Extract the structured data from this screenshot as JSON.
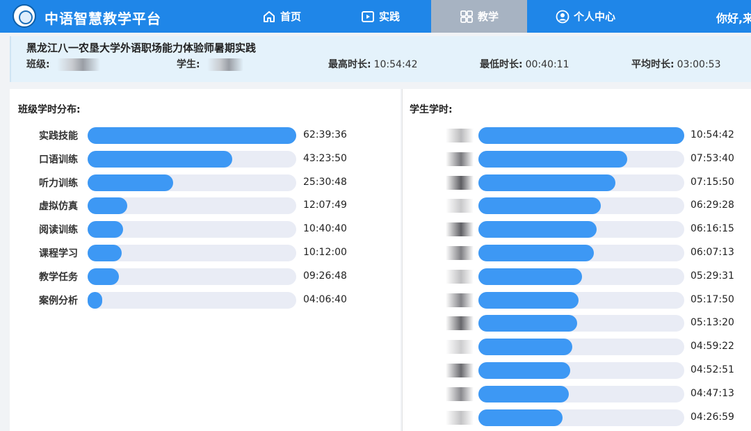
{
  "app": {
    "title": "中语智慧教学平台",
    "greeting": "你好,来"
  },
  "nav": [
    {
      "label": "首页",
      "icon": "home-icon"
    },
    {
      "label": "实践",
      "icon": "play-icon"
    },
    {
      "label": "教学",
      "icon": "grid-icon",
      "active": true
    },
    {
      "label": "个人中心",
      "icon": "user-icon"
    }
  ],
  "course": {
    "title": "黑龙江八一农垦大学外语职场能力体验师暑期实践",
    "class_label": "班级:",
    "student_label": "学生:",
    "max_label": "最高时长:",
    "max_value": "10:54:42",
    "min_label": "最低时长:",
    "min_value": "00:40:11",
    "avg_label": "平均时长:",
    "avg_value": "03:00:53"
  },
  "class_distribution": {
    "title": "班级学时分布:",
    "rows": [
      {
        "label": "实践技能",
        "value": "62:39:36",
        "fill": 1.0
      },
      {
        "label": "口语训练",
        "value": "43:23:50",
        "fill": 0.693
      },
      {
        "label": "听力训练",
        "value": "25:30:48",
        "fill": 0.41
      },
      {
        "label": "虚拟仿真",
        "value": "12:07:49",
        "fill": 0.19
      },
      {
        "label": "阅读训练",
        "value": "10:40:40",
        "fill": 0.17
      },
      {
        "label": "课程学习",
        "value": "10:12:00",
        "fill": 0.162
      },
      {
        "label": "教学任务",
        "value": "09:26:48",
        "fill": 0.15
      },
      {
        "label": "案例分析",
        "value": "04:06:40",
        "fill": 0.068
      }
    ]
  },
  "student_hours": {
    "title": "学生学时:",
    "rows": [
      {
        "value": "10:54:42",
        "fill": 1.0
      },
      {
        "value": "07:53:40",
        "fill": 0.723
      },
      {
        "value": "07:15:50",
        "fill": 0.666
      },
      {
        "value": "06:29:28",
        "fill": 0.595
      },
      {
        "value": "06:16:15",
        "fill": 0.574
      },
      {
        "value": "06:07:13",
        "fill": 0.561
      },
      {
        "value": "05:29:31",
        "fill": 0.503
      },
      {
        "value": "05:17:50",
        "fill": 0.485
      },
      {
        "value": "05:13:20",
        "fill": 0.479
      },
      {
        "value": "04:59:22",
        "fill": 0.457
      },
      {
        "value": "04:52:51",
        "fill": 0.447
      },
      {
        "value": "04:47:13",
        "fill": 0.439
      },
      {
        "value": "04:26:59",
        "fill": 0.408
      }
    ]
  },
  "colors": {
    "header": "#1f86e8",
    "bar": "#3d98f4",
    "track": "#e9ecf5",
    "active_tab": "#a7b3c2"
  }
}
